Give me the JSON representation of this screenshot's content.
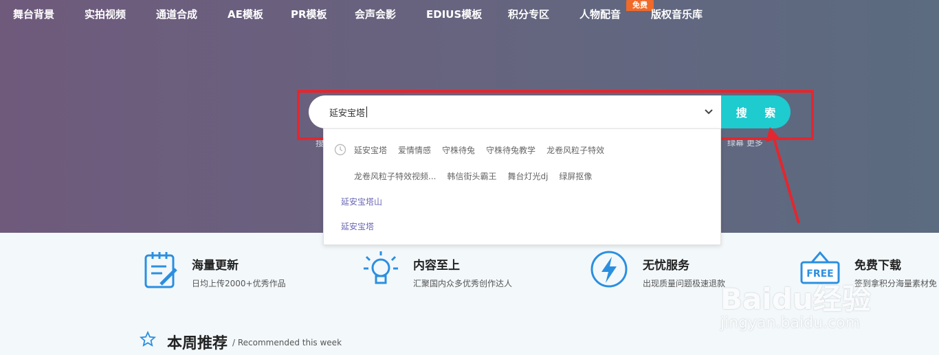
{
  "nav": {
    "items": [
      "舞台背景",
      "实拍视频",
      "通道合成",
      "AE模板",
      "PR模板",
      "会声会影",
      "EDIUS模板",
      "积分专区",
      "人物配音",
      "版权音乐库"
    ],
    "free_badge": "免费"
  },
  "search": {
    "value": "延安宝塔",
    "button_label": "搜 索",
    "hot_left": "搜",
    "hot_right": "绿幕  更多"
  },
  "suggestions": {
    "history_row1": [
      "延安宝塔",
      "爱情情感",
      "守株待兔",
      "守株待兔教学",
      "龙卷风粒子特效"
    ],
    "history_row2": [
      "龙卷风粒子特效视频...",
      "韩信街头霸王",
      "舞台灯光dj",
      "绿屏抠像"
    ],
    "items": [
      "延安宝塔山",
      "延安宝塔"
    ]
  },
  "features": [
    {
      "title": "海量更新",
      "desc": "日均上传2000+优秀作品",
      "icon": "notepad-edit-icon"
    },
    {
      "title": "内容至上",
      "desc": "汇聚国内众多优秀创作达人",
      "icon": "lightbulb-icon"
    },
    {
      "title": "无忧服务",
      "desc": "出现质量问题极速退款",
      "icon": "lightning-icon"
    },
    {
      "title": "免费下载",
      "desc": "签到拿积分海量素材免",
      "icon": "free-sign-icon"
    }
  ],
  "weekly": {
    "title": "本周推荐",
    "subtitle": "/ Recommended this week"
  },
  "watermark": {
    "logo": "Baidu经验",
    "url": "jingyan.baidu.com"
  },
  "colors": {
    "accent": "#1ecbcf",
    "highlight": "#e4262e",
    "badge": "#f06a2a",
    "icon_blue": "#2b8fe0",
    "suggest_link": "#6a67b6"
  }
}
